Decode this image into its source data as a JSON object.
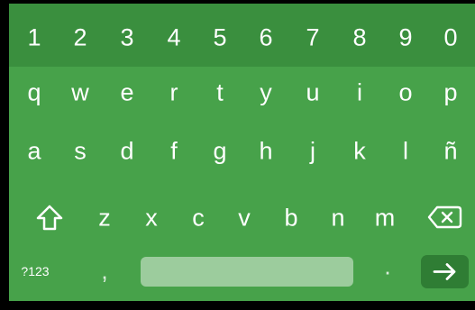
{
  "keyboard": {
    "number_row": [
      "1",
      "2",
      "3",
      "4",
      "5",
      "6",
      "7",
      "8",
      "9",
      "0"
    ],
    "row_1": [
      "q",
      "w",
      "e",
      "r",
      "t",
      "y",
      "u",
      "i",
      "o",
      "p"
    ],
    "row_2": [
      "a",
      "s",
      "d",
      "f",
      "g",
      "h",
      "j",
      "k",
      "l",
      "ñ"
    ],
    "row_3": [
      "z",
      "x",
      "c",
      "v",
      "b",
      "n",
      "m"
    ],
    "bottom_row": {
      "symbols_label": "?123",
      "comma_label": ",",
      "period_label": "."
    },
    "icons": {
      "shift": "shift-arrow-icon",
      "backspace": "backspace-icon",
      "enter": "arrow-right-icon"
    },
    "colors": {
      "keyboard_bg": "#47a24a",
      "number_row_bg": "#3a8f3e",
      "spacebar_bg": "#9ccc9d",
      "enter_bg": "#2f7d34",
      "key_text": "#ffffff"
    }
  }
}
